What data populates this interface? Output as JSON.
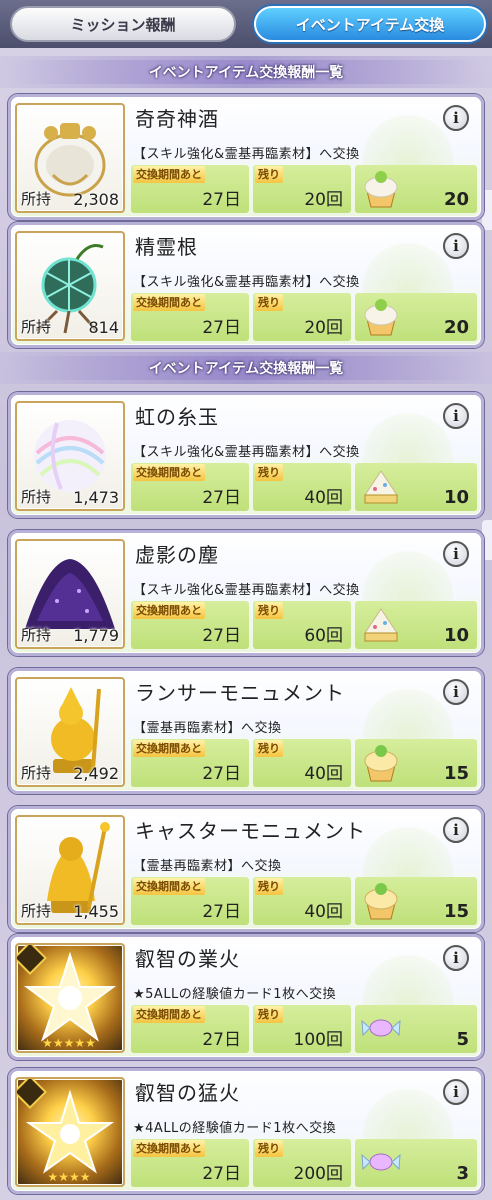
{
  "tabs": {
    "left": "ミッション報酬",
    "right": "イベントアイテム交換"
  },
  "section_title": "イベントアイテム交換報酬一覧",
  "labels": {
    "owned": "所持",
    "period": "交換期間あと",
    "remaining": "残り"
  },
  "items": [
    {
      "name": "奇奇神酒",
      "desc": "【スキル強化&霊基再臨素材】へ交換",
      "owned": "2,308",
      "period": "27日",
      "remaining": "20回",
      "cost": "20",
      "image": "sacred-wine-icon",
      "cost_icon": "cupcake-green-icon"
    },
    {
      "name": "精霊根",
      "desc": "【スキル強化&霊基再臨素材】へ交換",
      "owned": "814",
      "period": "27日",
      "remaining": "20回",
      "cost": "20",
      "image": "spirit-root-icon",
      "cost_icon": "cupcake-green-icon"
    },
    {
      "name": "虹の糸玉",
      "desc": "【スキル強化&霊基再臨素材】へ交換",
      "owned": "1,473",
      "period": "27日",
      "remaining": "40回",
      "cost": "10",
      "image": "rainbow-yarn-icon",
      "cost_icon": "cake-slice-icon"
    },
    {
      "name": "虚影の塵",
      "desc": "【スキル強化&霊基再臨素材】へ交換",
      "owned": "1,779",
      "period": "27日",
      "remaining": "60回",
      "cost": "10",
      "image": "ghost-dust-icon",
      "cost_icon": "cake-slice-icon"
    },
    {
      "name": "ランサーモニュメント",
      "desc": "【霊基再臨素材】へ交換",
      "owned": "2,492",
      "period": "27日",
      "remaining": "40回",
      "cost": "15",
      "image": "lancer-monument-icon",
      "cost_icon": "cupcake-yellow-icon"
    },
    {
      "name": "キャスターモニュメント",
      "desc": "【霊基再臨素材】へ交換",
      "owned": "1,455",
      "period": "27日",
      "remaining": "40回",
      "cost": "15",
      "image": "caster-monument-icon",
      "cost_icon": "cupcake-yellow-icon"
    },
    {
      "name": "叡智の業火",
      "desc": "★5ALLの経験値カード1枚へ交換",
      "owned": "",
      "period": "27日",
      "remaining": "100回",
      "cost": "5",
      "image": "exp-card-5star-icon",
      "cost_icon": "candy-icon"
    },
    {
      "name": "叡智の猛火",
      "desc": "★4ALLの経験値カード1枚へ交換",
      "owned": "",
      "period": "27日",
      "remaining": "200回",
      "cost": "3",
      "image": "exp-card-4star-icon",
      "cost_icon": "candy-icon"
    }
  ],
  "colors": {
    "stat_box": "#c8e68a",
    "frame": "#b7b1d8",
    "tab_active": "#2a8be0"
  }
}
